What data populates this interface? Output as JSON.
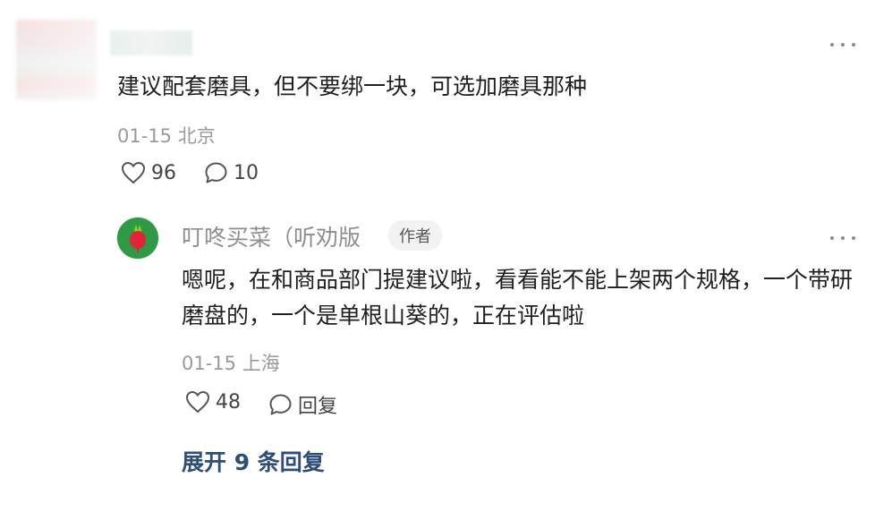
{
  "comment": {
    "text": "建议配套磨具，但不要绑一块，可选加磨具那种",
    "meta": "01-15 北京",
    "likes": "96",
    "replies": "10"
  },
  "reply": {
    "author": "叮咚买菜（听劝版",
    "badge": "作者",
    "text": "嗯呢，在和商品部门提建议啦，看看能不能上架两个规格，一个带研磨盘的，一个是单根山葵的，正在评估啦",
    "meta": "01-15 上海",
    "likes": "48",
    "reply_label": "回复"
  },
  "expand_label": "展开 9 条回复",
  "colors": {
    "brand_green": "#2e9a45",
    "link_blue": "#2d4e7a",
    "meta_gray": "#9a9a9a"
  },
  "icons": [
    "more-icon",
    "heart-icon",
    "comment-icon",
    "radish-logo"
  ]
}
